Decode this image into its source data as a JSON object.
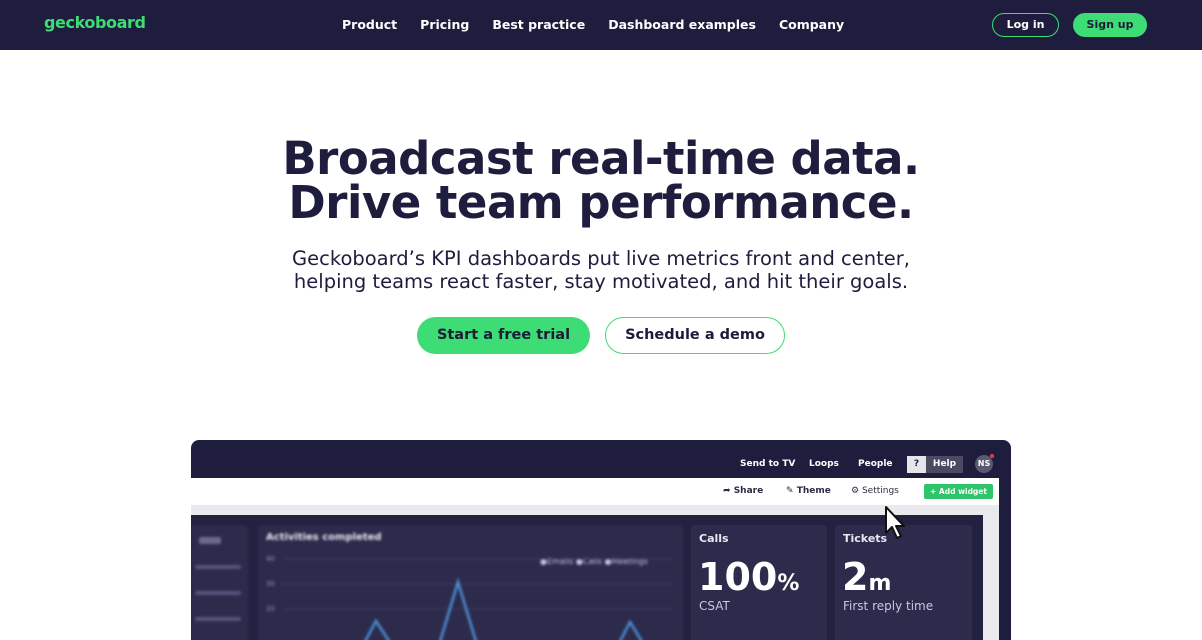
{
  "nav": {
    "logo": "geckoboard",
    "links": [
      "Product",
      "Pricing",
      "Best practice",
      "Dashboard examples",
      "Company"
    ],
    "login": "Log in",
    "signup": "Sign up"
  },
  "hero": {
    "title_line1": "Broadcast real-time data.",
    "title_line2": "Drive team performance.",
    "subtitle_line1": "Geckoboard’s KPI dashboards put live metrics front and center,",
    "subtitle_line2": "helping teams react faster, stay motivated, and hit their goals.",
    "cta_primary": "Start a free trial",
    "cta_secondary": "Schedule a demo"
  },
  "preview": {
    "topbar": {
      "send_to_tv": "Send to TV",
      "loops": "Loops",
      "people": "People",
      "help_q": "?",
      "help": "Help",
      "avatar": "NS"
    },
    "toolbar": {
      "share": "Share",
      "theme": "Theme",
      "settings": "Settings",
      "add_widget": "+ Add widget"
    },
    "widgets": {
      "activities_title": "Activities completed",
      "legend": "●Emails ●Calls ●Meetings",
      "y_ticks": [
        "40",
        "30",
        "20"
      ],
      "calls_title": "Calls",
      "calls_value": "100",
      "calls_unit": "%",
      "calls_label": "CSAT",
      "tickets_title": "Tickets",
      "tickets_value": "2",
      "tickets_unit": "m",
      "tickets_label": "First reply time"
    },
    "colors": {
      "accent": "#3ddc74",
      "navy": "#1f1d3d"
    }
  }
}
